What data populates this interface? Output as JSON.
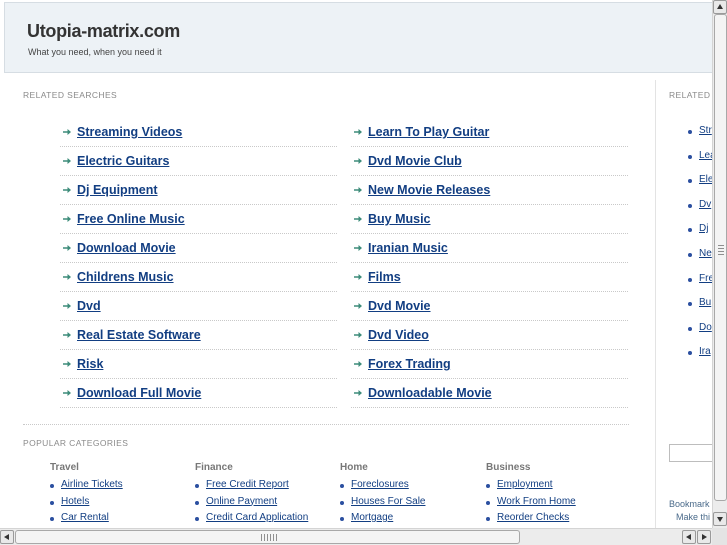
{
  "header": {
    "title": "Utopia-matrix.com",
    "tagline": "What you need, when you need it"
  },
  "related_searches": {
    "label": "RELATED SEARCHES",
    "column1": [
      "Streaming Videos",
      "Electric Guitars",
      "Dj Equipment",
      "Free Online Music",
      "Download Movie",
      "Childrens Music",
      "Dvd",
      "Real Estate Software",
      "Risk",
      "Download Full Movie"
    ],
    "column2": [
      "Learn To Play Guitar",
      "Dvd Movie Club",
      "New Movie Releases",
      "Buy Music",
      "Iranian Music",
      "Films",
      "Dvd Movie",
      "Dvd Video",
      "Forex Trading",
      "Downloadable Movie"
    ]
  },
  "popular_categories": {
    "label": "POPULAR CATEGORIES",
    "categories": [
      {
        "title": "Travel",
        "items": [
          "Airline Tickets",
          "Hotels",
          "Car Rental"
        ]
      },
      {
        "title": "Finance",
        "items": [
          "Free Credit Report",
          "Online Payment",
          "Credit Card Application"
        ]
      },
      {
        "title": "Home",
        "items": [
          "Foreclosures",
          "Houses For Sale",
          "Mortgage"
        ]
      },
      {
        "title": "Business",
        "items": [
          "Employment",
          "Work From Home",
          "Reorder Checks"
        ]
      }
    ]
  },
  "right_panel": {
    "label": "RELATED",
    "items": [
      "Str",
      "Lea",
      "Ele",
      "Dv",
      "Dj",
      "Ne",
      "Fre",
      "Bu",
      "Do",
      "Ira"
    ],
    "bookmark_text": "Bookmark",
    "make_text": "Make thi"
  },
  "colors": {
    "link": "#123e82",
    "arrow": "#3d8c7a",
    "header_bg": "#edf2f6"
  }
}
